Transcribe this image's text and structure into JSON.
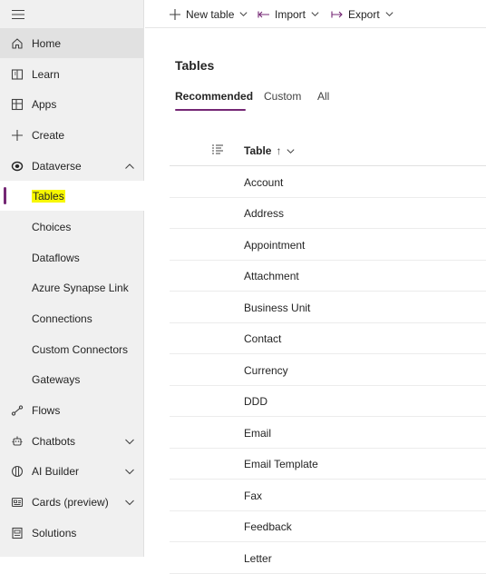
{
  "sidebar": {
    "home": "Home",
    "learn": "Learn",
    "apps": "Apps",
    "create": "Create",
    "dataverse": "Dataverse",
    "sub": {
      "tables": "Tables",
      "choices": "Choices",
      "dataflows": "Dataflows",
      "azure_synapse": "Azure Synapse Link",
      "connections": "Connections",
      "custom_connectors": "Custom Connectors",
      "gateways": "Gateways"
    },
    "flows": "Flows",
    "chatbots": "Chatbots",
    "ai_builder": "AI Builder",
    "cards": "Cards (preview)",
    "solutions": "Solutions"
  },
  "toolbar": {
    "new_table": "New table",
    "import": "Import",
    "export": "Export"
  },
  "main": {
    "title": "Tables",
    "tabs": [
      "Recommended",
      "Custom",
      "All"
    ],
    "active_tab": "Recommended",
    "column_header": "Table",
    "sort_arrow": "↑",
    "rows": [
      "Account",
      "Address",
      "Appointment",
      "Attachment",
      "Business Unit",
      "Contact",
      "Currency",
      "DDD",
      "Email",
      "Email Template",
      "Fax",
      "Feedback",
      "Letter"
    ]
  },
  "colors": {
    "accent": "#742774",
    "highlight": "#f7f700",
    "sidebar_bg": "#f0f0f0"
  },
  "icons": {
    "hamburger": "hamburger-icon",
    "home": "home-icon",
    "learn": "book-icon",
    "apps": "apps-icon",
    "create": "plus-icon",
    "dataverse": "dataverse-icon",
    "flows": "flow-icon",
    "chatbots": "bot-icon",
    "ai_builder": "ai-builder-icon",
    "cards": "cards-icon",
    "solutions": "solutions-icon"
  }
}
